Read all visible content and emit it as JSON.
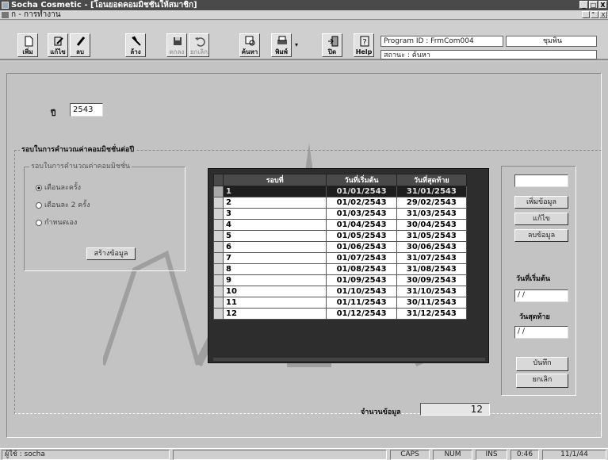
{
  "window": {
    "title": "Socha Cosmetic - [โอนยอดคอมมิชชั่นให้สมาชิก]",
    "minimize_glyph": "_",
    "maximize_glyph": "□",
    "close_glyph": "X"
  },
  "menu": {
    "item": "ก - การทำงาน",
    "mdi_minimize": "_",
    "mdi_restore": "ื",
    "mdi_close": "X"
  },
  "toolbar": {
    "buttons": [
      {
        "label": "เพิ่ม",
        "icon": "new-document-icon"
      },
      {
        "label": "แก้ไข",
        "icon": "edit-icon"
      },
      {
        "label": "ลบ",
        "icon": "delete-icon"
      },
      {
        "label": "ล้าง",
        "icon": "clear-icon"
      },
      {
        "label": "ตกลง",
        "icon": "save-icon"
      },
      {
        "label": "ยกเลิก",
        "icon": "undo-icon"
      },
      {
        "label": "ค้นหา",
        "icon": "search-icon"
      },
      {
        "label": "พิมพ์",
        "icon": "printer-icon"
      },
      {
        "label": "ปิด",
        "icon": "exit-icon"
      },
      {
        "label": "Help",
        "icon": "help-icon"
      }
    ],
    "print_dropdown": "▾"
  },
  "info": {
    "program_id": "Program ID : FrmCom004",
    "user": "ชุมพิน",
    "status": "สถานะ : ค้นหา"
  },
  "form": {
    "year_label": "ปี",
    "year_value": "2543",
    "outer_group_title": "รอบในการคำนวณค่าคอมมิชชั่นต่อปี",
    "period_group_title": "รอบในการคำนวณค่าคอมมิชชั่น",
    "radio_options": [
      "เดือนละครั้ง",
      "เดือนละ 2 ครั้ง",
      "กำหนดเอง"
    ],
    "create_button": "สร้างข้อมูล"
  },
  "grid": {
    "columns": [
      "รอบที่",
      "วันที่เริ่มต้น",
      "วันที่สุดท้าย"
    ],
    "rows": [
      [
        "1",
        "01/01/2543",
        "31/01/2543"
      ],
      [
        "2",
        "01/02/2543",
        "29/02/2543"
      ],
      [
        "3",
        "01/03/2543",
        "31/03/2543"
      ],
      [
        "4",
        "01/04/2543",
        "30/04/2543"
      ],
      [
        "5",
        "01/05/2543",
        "31/05/2543"
      ],
      [
        "6",
        "01/06/2543",
        "30/06/2543"
      ],
      [
        "7",
        "01/07/2543",
        "31/07/2543"
      ],
      [
        "8",
        "01/08/2543",
        "31/08/2543"
      ],
      [
        "9",
        "01/09/2543",
        "30/09/2543"
      ],
      [
        "10",
        "01/10/2543",
        "31/10/2543"
      ],
      [
        "11",
        "01/11/2543",
        "30/11/2543"
      ],
      [
        "12",
        "01/12/2543",
        "31/12/2543"
      ]
    ],
    "selected_row": 0
  },
  "right_panel": {
    "add_button": "เพิ่มข้อมูล",
    "edit_button": "แก้ไข",
    "delete_button": "ลบข้อมูล",
    "start_date_label": "วันที่เริ่มต้น",
    "start_date_value": "/ /",
    "end_date_label": "วันสุดท้าย",
    "end_date_value": "/ /",
    "save_button": "บันทึก",
    "cancel_button": "ยกเลิก"
  },
  "count": {
    "label": "จำนวนข้อมูล",
    "value": "12"
  },
  "statusbar": {
    "user": "ผู้ใช้ : socha",
    "caps": "CAPS",
    "num": "NUM",
    "ins": "INS",
    "time": "0:46",
    "date": "11/1/44"
  }
}
